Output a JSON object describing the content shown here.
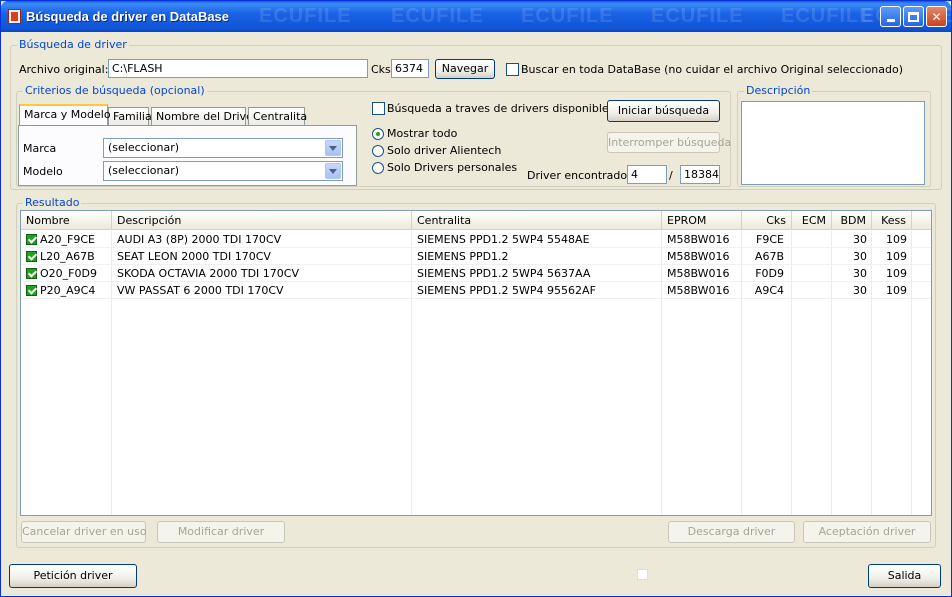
{
  "window": {
    "title": "Búsqueda de  driver en DataBase",
    "watermark": [
      "ECUFILE",
      "ECUFILE",
      "ECUFILE",
      "ECUFILE",
      "ECUFILE",
      "ECUFILE"
    ]
  },
  "busqueda": {
    "group_label": "Búsqueda de driver",
    "archivo_label": "Archivo original:",
    "archivo_value": "C:\\FLASH",
    "cks_label": "Cks",
    "cks_value": "6374",
    "navegar_label": "Navegar",
    "buscar_toda_label": "Buscar en toda DataBase (no cuidar el archivo Original seleccionado)"
  },
  "criterios": {
    "group_label": "Criterios de búsqueda (opcional)",
    "tabs": [
      {
        "label": "Marca y Modelo"
      },
      {
        "label": "Familia"
      },
      {
        "label": "Nombre del Driver"
      },
      {
        "label": "Centralita"
      }
    ],
    "marca_label": "Marca",
    "marca_value": "(seleccionar)",
    "modelo_label": "Modelo",
    "modelo_value": "(seleccionar)",
    "busqueda_traves_label": "Búsqueda a traves de drivers disponibles",
    "radios": [
      {
        "label": "Mostrar todo"
      },
      {
        "label": "Solo driver Alientech"
      },
      {
        "label": "Solo Drivers personales"
      }
    ],
    "iniciar_label": "Iniciar búsqueda",
    "interrumpir_label": "Interromper búsqueda",
    "encontrado_label": "Driver encontrado:",
    "encontrado_value": "4",
    "slash": "/",
    "total_value": "18384"
  },
  "descripcion": {
    "group_label": "Descripción"
  },
  "resultado": {
    "group_label": "Resultado",
    "columns": [
      "Nombre",
      "Descripción",
      "Centralita",
      "EPROM",
      "Cks",
      "ECM",
      "BDM",
      "Kess"
    ],
    "rows": [
      {
        "nombre": "A20_F9CE",
        "descripcion": "AUDI A3 (8P) 2000 TDI 170CV",
        "centralita": "SIEMENS PPD1.2 5WP4 5548AE",
        "eprom": "M58BW016",
        "cks": "F9CE",
        "ecm": "",
        "bdm": "30",
        "kess": "109"
      },
      {
        "nombre": "L20_A67B",
        "descripcion": "SEAT LEON 2000 TDI 170CV",
        "centralita": "SIEMENS PPD1.2",
        "eprom": "M58BW016",
        "cks": "A67B",
        "ecm": "",
        "bdm": "30",
        "kess": "109"
      },
      {
        "nombre": "O20_F0D9",
        "descripcion": "SKODA OCTAVIA 2000 TDI 170CV",
        "centralita": "SIEMENS PPD1.2 5WP4 5637AA",
        "eprom": "M58BW016",
        "cks": "F0D9",
        "ecm": "",
        "bdm": "30",
        "kess": "109"
      },
      {
        "nombre": "P20_A9C4",
        "descripcion": "VW PASSAT 6 2000 TDI 170CV",
        "centralita": "SIEMENS PPD1.2 5WP4 95562AF",
        "eprom": "M58BW016",
        "cks": "A9C4",
        "ecm": "",
        "bdm": "30",
        "kess": "109"
      }
    ]
  },
  "buttons": {
    "cancelar": "Cancelar driver en uso",
    "modificar": "Modificar driver",
    "descarga": "Descarga driver",
    "aceptacion": "Aceptación driver",
    "peticion": "Petición driver",
    "salida": "Salida"
  }
}
